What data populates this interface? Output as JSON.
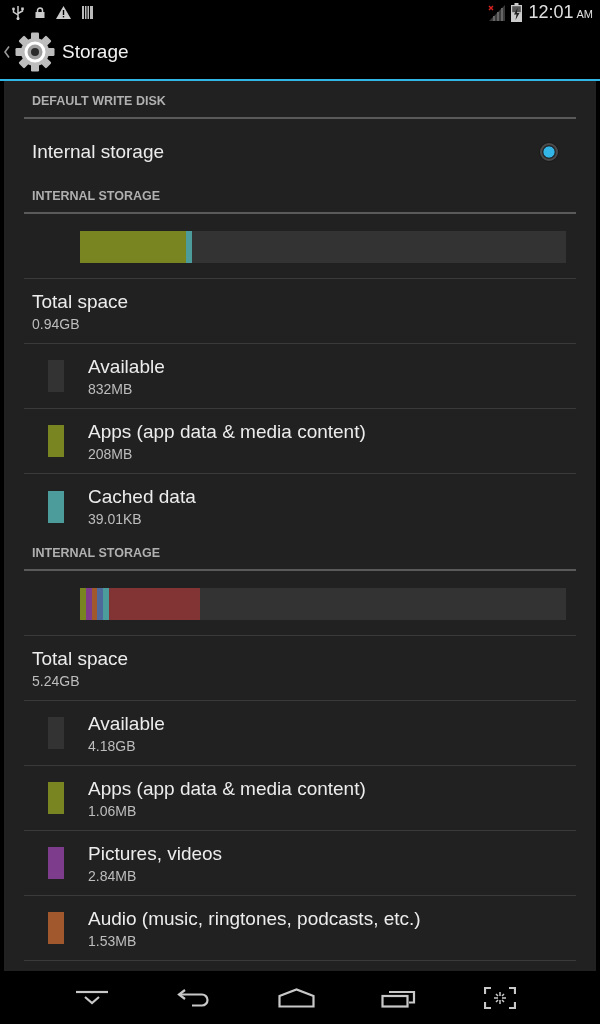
{
  "status_bar": {
    "time": "12:01",
    "meridiem": "AM"
  },
  "action_bar": {
    "title": "Storage"
  },
  "sections": [
    {
      "kind": "choice",
      "header": "DEFAULT WRITE DISK",
      "options": [
        {
          "label": "Internal storage",
          "selected": true
        }
      ]
    },
    {
      "kind": "usage",
      "header": "INTERNAL STORAGE",
      "bar": {
        "segments": [
          {
            "color": "#788520",
            "level": 0.218
          },
          {
            "color": "#4c9c9c",
            "level": 0.012
          }
        ]
      },
      "total": {
        "label": "Total space",
        "value": "0.94GB"
      },
      "items": [
        {
          "label": "Available",
          "value": "832MB",
          "color": "#333333"
        },
        {
          "label": "Apps (app data & media content)",
          "value": "208MB",
          "color": "#788520"
        },
        {
          "label": "Cached data",
          "value": "39.01KB",
          "color": "#4c9c9c"
        }
      ]
    },
    {
      "kind": "usage",
      "header": "INTERNAL STORAGE",
      "bar": {
        "segments": [
          {
            "color": "#788520",
            "level": 0.012
          },
          {
            "color": "#7e3c8c",
            "level": 0.012
          },
          {
            "color": "#a0582c",
            "level": 0.012
          },
          {
            "color": "#4d6a9b",
            "level": 0.012
          },
          {
            "color": "#4c9c9c",
            "level": 0.012
          },
          {
            "color": "#823434",
            "level": 0.187
          }
        ]
      },
      "total": {
        "label": "Total space",
        "value": "5.24GB"
      },
      "items": [
        {
          "label": "Available",
          "value": "4.18GB",
          "color": "#333333"
        },
        {
          "label": "Apps (app data & media content)",
          "value": "1.06MB",
          "color": "#788520"
        },
        {
          "label": "Pictures, videos",
          "value": "2.84MB",
          "color": "#7e3c8c"
        },
        {
          "label": "Audio (music, ringtones, podcasts, etc.)",
          "value": "1.53MB",
          "color": "#a0582c"
        }
      ]
    }
  ]
}
